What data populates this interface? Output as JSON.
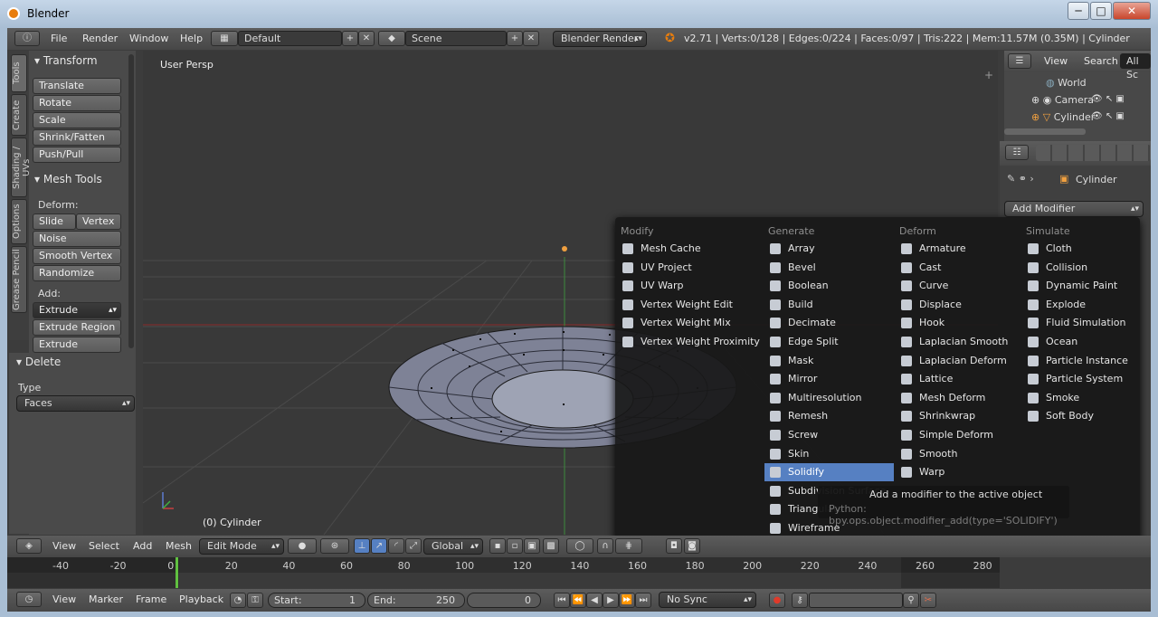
{
  "window": {
    "title": "Blender",
    "controls": [
      "─",
      "□",
      "✕"
    ]
  },
  "info_header": {
    "menus": [
      "File",
      "Render",
      "Window",
      "Help"
    ],
    "layout": "Default",
    "scene": "Scene",
    "engine": "Blender Render",
    "stats": "v2.71 | Verts:0/128 | Edges:0/224 | Faces:0/97 | Tris:222 | Mem:11.57M (0.35M) | Cylinder"
  },
  "tool_tabs": [
    "Tools",
    "Create",
    "Shading / UVs",
    "Options",
    "Grease Pencil"
  ],
  "tool_panel": {
    "transform": {
      "title": "Transform",
      "buttons": [
        "Translate",
        "Rotate",
        "Scale",
        "Shrink/Fatten",
        "Push/Pull"
      ]
    },
    "mesh_tools": {
      "title": "Mesh Tools",
      "deform_label": "Deform:",
      "slide_edge": "Slide Ed",
      "vertex": "Vertex",
      "deform_buttons": [
        "Noise",
        "Smooth Vertex",
        "Randomize"
      ],
      "add_label": "Add:",
      "extrude": "Extrude",
      "add_buttons": [
        "Extrude Region",
        "Extrude Individual"
      ]
    },
    "delete": {
      "title": "Delete",
      "type_label": "Type",
      "type_value": "Faces"
    }
  },
  "viewport": {
    "view_name": "User Persp",
    "object_label": "(0) Cylinder"
  },
  "add_modifier_menu": {
    "columns": [
      {
        "header": "Modify",
        "items": [
          "Mesh Cache",
          "UV Project",
          "UV Warp",
          "Vertex Weight Edit",
          "Vertex Weight Mix",
          "Vertex Weight Proximity"
        ]
      },
      {
        "header": "Generate",
        "items": [
          "Array",
          "Bevel",
          "Boolean",
          "Build",
          "Decimate",
          "Edge Split",
          "Mask",
          "Mirror",
          "Multiresolution",
          "Remesh",
          "Screw",
          "Skin",
          "Solidify",
          "Subdivision Surface",
          "Triangulate",
          "Wireframe"
        ]
      },
      {
        "header": "Deform",
        "items": [
          "Armature",
          "Cast",
          "Curve",
          "Displace",
          "Hook",
          "Laplacian Smooth",
          "Laplacian Deform",
          "Lattice",
          "Mesh Deform",
          "Shrinkwrap",
          "Simple Deform",
          "Smooth",
          "Warp"
        ]
      },
      {
        "header": "Simulate",
        "items": [
          "Cloth",
          "Collision",
          "Dynamic Paint",
          "Explode",
          "Fluid Simulation",
          "Ocean",
          "Particle Instance",
          "Particle System",
          "Smoke",
          "Soft Body"
        ]
      }
    ],
    "highlighted": "Solidify",
    "tooltip": {
      "title": "Add a modifier to the active object",
      "python": "Python: bpy.ops.object.modifier_add(type='SOLIDIFY')"
    }
  },
  "outliner": {
    "menus": [
      "View",
      "Search"
    ],
    "filter": "All Sc",
    "items": [
      "World",
      "Camera",
      "Cylinder"
    ]
  },
  "properties": {
    "object_name": "Cylinder",
    "add_modifier": "Add Modifier"
  },
  "view3d_header": {
    "menus": [
      "View",
      "Select",
      "Add",
      "Mesh"
    ],
    "mode": "Edit Mode",
    "orientation": "Global"
  },
  "timeline": {
    "ticks": [
      "-40",
      "-20",
      "0",
      "20",
      "40",
      "60",
      "80",
      "100",
      "120",
      "140",
      "160",
      "180",
      "200",
      "220",
      "240",
      "260",
      "280"
    ],
    "current_frame": "0"
  },
  "timeline_header": {
    "menus": [
      "View",
      "Marker",
      "Frame",
      "Playback"
    ],
    "start_label": "Start:",
    "start_value": "1",
    "end_label": "End:",
    "end_value": "250",
    "frame_value": "0",
    "sync": "No Sync"
  }
}
